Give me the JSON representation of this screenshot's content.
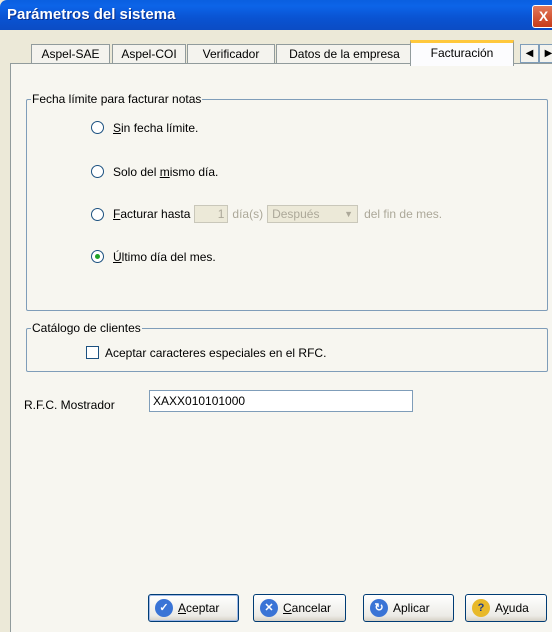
{
  "window": {
    "title": "Parámetros del sistema",
    "close_glyph": "X"
  },
  "tabs": [
    {
      "label": "Aspel-SAE",
      "active": false
    },
    {
      "label": "Aspel-COI",
      "active": false
    },
    {
      "label": "Verificador",
      "active": false
    },
    {
      "label": "Datos de la empresa",
      "active": false
    },
    {
      "label": "Facturación",
      "active": true
    }
  ],
  "tab_scroll": {
    "left_glyph": "◀",
    "right_glyph": "▶"
  },
  "fecha_group": {
    "legend": "Fecha límite para facturar notas",
    "options": {
      "sin_fecha": {
        "access_key": "S",
        "rest": "in fecha límite.",
        "selected": false
      },
      "solo_mismo": {
        "prefix": "Solo del ",
        "access_key": "m",
        "rest": "ismo día.",
        "selected": false
      },
      "facturar_hasta": {
        "access_key": "F",
        "rest": "acturar hasta",
        "selected": false
      },
      "ultimo_dia": {
        "access_key": "Ú",
        "rest": "ltimo día del mes.",
        "selected": true
      }
    },
    "days_value": "1",
    "days_label": "día(s)",
    "when_value": "Después",
    "suffix": "del fin de mes."
  },
  "clientes_group": {
    "legend": "Catálogo de clientes",
    "checkbox_label": "Aceptar caracteres especiales en el RFC.",
    "checked": false
  },
  "rfc": {
    "label": "R.F.C. Mostrador",
    "value": "XAXX010101000"
  },
  "buttons": {
    "aceptar": {
      "access_key": "A",
      "rest": "ceptar",
      "icon": "check-icon"
    },
    "cancelar": {
      "access_key": "C",
      "rest": "ancelar",
      "icon": "x-icon"
    },
    "aplicar": {
      "label": "Aplicar",
      "icon": "refresh-icon"
    },
    "ayuda": {
      "prefix": "A",
      "access_key": "y",
      "rest": "uda",
      "icon": "help-icon"
    }
  },
  "colors": {
    "titlebar": "#0A5FE0",
    "dialog_bg": "#ECE9D8",
    "active_tab_highlight": "#FFC83C",
    "radio_dot": "#20A126"
  }
}
